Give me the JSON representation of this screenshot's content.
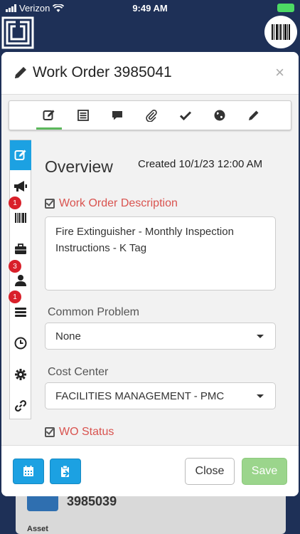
{
  "status_bar": {
    "carrier": "Verizon",
    "time": "9:49 AM"
  },
  "modal": {
    "title": "Work Order 3985041",
    "close_symbol": "×",
    "tabs": [
      {
        "icon": "edit-icon",
        "active": true
      },
      {
        "icon": "list-icon",
        "active": false
      },
      {
        "icon": "comment-icon",
        "active": false
      },
      {
        "icon": "paperclip-icon",
        "active": false
      },
      {
        "icon": "check-icon",
        "active": false
      },
      {
        "icon": "globe-icon",
        "active": false
      },
      {
        "icon": "pencil-icon",
        "active": false
      }
    ],
    "side_nav": [
      {
        "icon": "edit-icon",
        "active": true,
        "badge": ""
      },
      {
        "icon": "megaphone-icon",
        "active": false,
        "badge": ""
      },
      {
        "icon": "barcode-icon",
        "active": false,
        "badge": "1"
      },
      {
        "icon": "briefcase-icon",
        "active": false,
        "badge": ""
      },
      {
        "icon": "user-icon",
        "active": false,
        "badge": "3"
      },
      {
        "icon": "stack-icon",
        "active": false,
        "badge": "1"
      },
      {
        "icon": "clock-icon",
        "active": false,
        "badge": ""
      },
      {
        "icon": "gear-icon",
        "active": false,
        "badge": ""
      },
      {
        "icon": "link-icon",
        "active": false,
        "badge": ""
      }
    ],
    "overview": {
      "title": "Overview",
      "created": "Created 10/1/23 12:00 AM",
      "description_label": "Work Order Description",
      "description_value": "Fire Extinguisher - Monthly Inspection Instructions - K Tag",
      "common_problem_label": "Common Problem",
      "common_problem_value": "None",
      "cost_center_label": "Cost Center",
      "cost_center_value": "FACILITIES MANAGEMENT - PMC",
      "status_label": "WO Status"
    },
    "footer": {
      "close_label": "Close",
      "save_label": "Save"
    }
  },
  "backdrop": {
    "work_order_number": "3985039",
    "asset_label": "Asset"
  },
  "colors": {
    "accent_blue": "#1ca1e2",
    "required_red": "#d9534f",
    "save_green": "#9bd58c",
    "navy": "#1e3057"
  }
}
